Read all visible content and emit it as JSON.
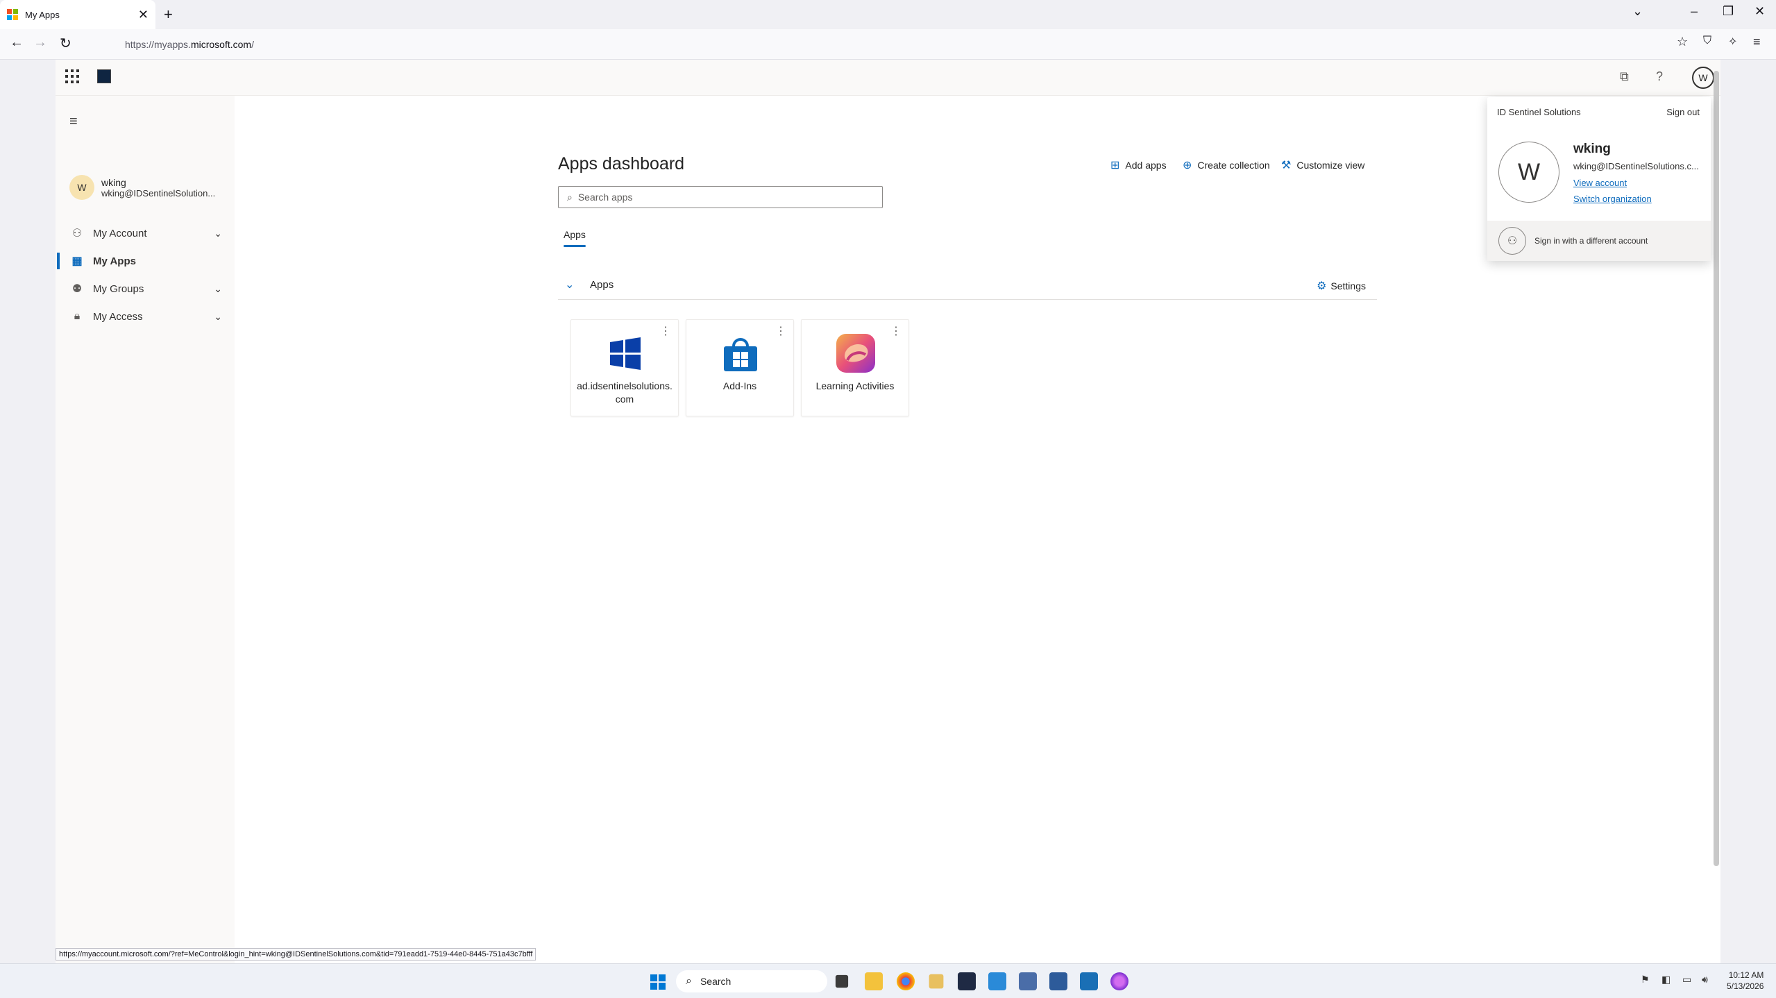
{
  "browser": {
    "tab_title": "My Apps",
    "url_prefix": "https://myapps.",
    "url_domain": "microsoft.com",
    "url_suffix": "/",
    "status_url": "https://myaccount.microsoft.com/?ref=MeControl&login_hint=wking@IDSentinelSolutions.com&tid=791eadd1-7519-44e0-8445-751a43c7bfff"
  },
  "sidebar": {
    "user_initial": "W",
    "user_name": "wking",
    "user_email": "wking@IDSentinelSolution...",
    "items": [
      {
        "label": "My Account",
        "icon": "person-icon",
        "expandable": true
      },
      {
        "label": "My Apps",
        "icon": "apps-icon",
        "active": true
      },
      {
        "label": "My Groups",
        "icon": "people-icon",
        "expandable": true
      },
      {
        "label": "My Access",
        "icon": "lock-icon",
        "expandable": true
      }
    ]
  },
  "main": {
    "title": "Apps dashboard",
    "actions": [
      "Add apps",
      "Create collection",
      "Customize view"
    ],
    "search_placeholder": "Search apps",
    "tab": "Apps",
    "section_label": "Apps",
    "settings_label": "Settings",
    "apps": [
      {
        "label": "ad.idsentinelsolutions.com",
        "icon": "windows-logo-icon"
      },
      {
        "label": "Add-Ins",
        "icon": "store-bag-icon"
      },
      {
        "label": "Learning Activities",
        "icon": "learning-activities-icon"
      }
    ]
  },
  "header": {
    "avatar_initial": "W"
  },
  "account_popup": {
    "org": "ID Sentinel Solutions",
    "sign_out": "Sign out",
    "initial": "W",
    "name": "wking",
    "email": "wking@IDSentinelSolutions.c...",
    "view_account": "View account",
    "switch_org": "Switch organization",
    "other_account": "Sign in with a different account"
  },
  "taskbar": {
    "search": "Search",
    "time": "10:12 AM",
    "date": "5/13/2026"
  },
  "colors": {
    "accent": "#0f6cbd",
    "windows_blue": "#0a3fa8"
  }
}
